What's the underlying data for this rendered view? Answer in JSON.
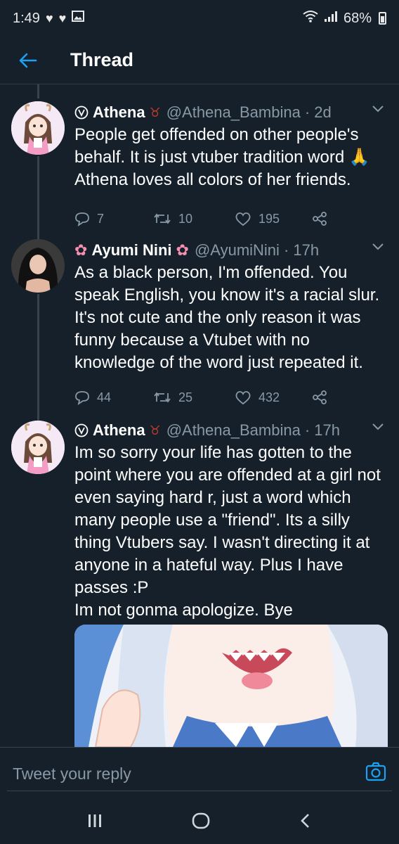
{
  "status_bar": {
    "time": "1:49",
    "battery": "68%"
  },
  "header": {
    "title": "Thread"
  },
  "tweets": [
    {
      "name": "Athena",
      "handle": "@Athena_Bambina",
      "time": "· 2d",
      "text": "People get offended on other people's behalf. It is just vtuber tradition word 🙏\nAthena loves all colors of her friends.",
      "replies": "7",
      "retweets": "10",
      "likes": "195"
    },
    {
      "name": "Ayumi Nini",
      "handle": "@AyumiNini",
      "time": "· 17h",
      "text": "As a black person, I'm offended. You speak English, you know it's a racial slur. It's not cute and the only reason it was funny because a Vtubet with no knowledge of the word just repeated it.",
      "replies": "44",
      "retweets": "25",
      "likes": "432"
    },
    {
      "name": "Athena",
      "handle": "@Athena_Bambina",
      "time": "· 17h",
      "text": "Im so sorry your life has gotten to the point where you are offended at a girl not even saying hard r, just a word which many people use a \"friend\". Its a silly thing Vtubers say. I wasn't directing it at anyone in a hateful way. Plus I have passes :P\nIm not gonma apologize. Bye"
    }
  ],
  "reply": {
    "placeholder": "Tweet your reply"
  },
  "colors": {
    "background": "#15202b",
    "accent": "#1da1f2",
    "secondary_text": "#8899a6",
    "divider": "#38444d"
  }
}
